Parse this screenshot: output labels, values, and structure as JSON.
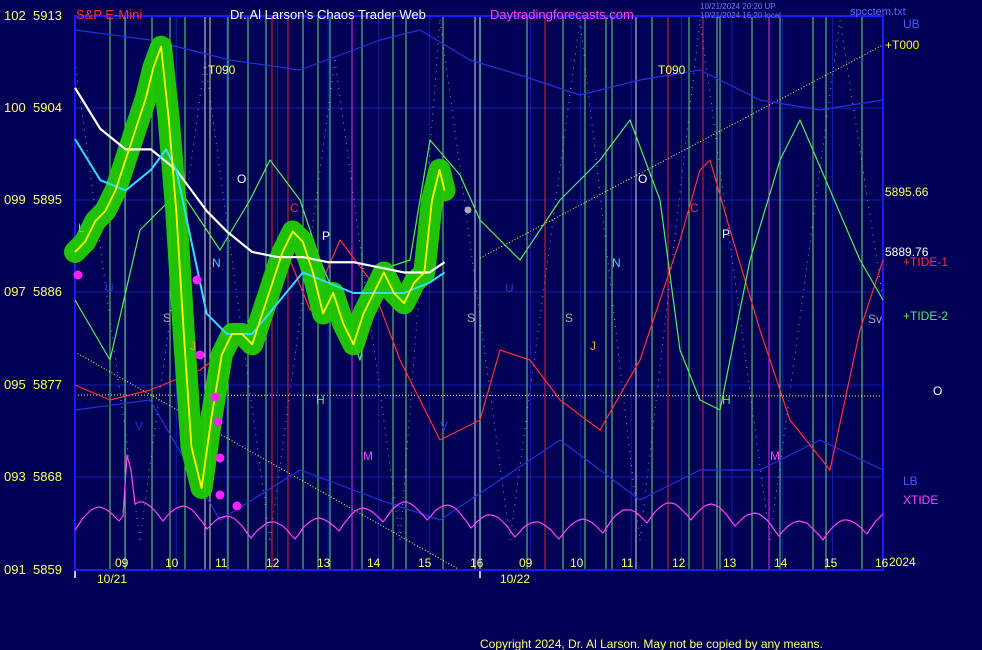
{
  "header": {
    "instrument": "S&P E-Mini",
    "title": "Dr. Al Larson's Chaos Trader Web",
    "website": "Daytradingforecasts.com",
    "stamp_line1": "10/21/2024 20:20 UP",
    "stamp_line2": "10/21/2024 16:20 local",
    "filename": "spcctem.txt"
  },
  "footer": {
    "copyright": "Copyright 2024, Dr. Al Larson. May not be copied by any means."
  },
  "colors": {
    "background": "#000055",
    "frame": "#1a1aff",
    "price_labels": "#ffff00",
    "tide1": "#ff3030",
    "tide2": "#55ee55",
    "xtide": "#ff44ff",
    "white_ma": "#ffffff",
    "cyan_ma": "#33ddff",
    "price": "#ffff00",
    "highlight": "#22cc00"
  },
  "chart_data": {
    "type": "line",
    "title": "S&P E-Mini",
    "y_axis": {
      "left_ticks": [
        "102",
        "100",
        "099",
        "097",
        "095",
        "093",
        "091"
      ],
      "right_ticks": [
        "5913",
        "5904",
        "5895",
        "5886",
        "5877",
        "5868",
        "5859"
      ],
      "ylim": [
        5859,
        5913
      ]
    },
    "x_axis": {
      "hour_labels": [
        "09",
        "10",
        "11",
        "12",
        "13",
        "14",
        "15",
        "16",
        "09",
        "10",
        "11",
        "12",
        "13",
        "14",
        "15",
        "16"
      ],
      "dates": [
        "10/21",
        "10/22"
      ],
      "year": "2024"
    },
    "right_labels": {
      "ub": "UB",
      "t000": "+T000",
      "level1": "5895.66",
      "level2": "5889.76",
      "tide1": "+TIDE-1",
      "tide2": "+TIDE-2",
      "o": "O",
      "lb": "LB",
      "xtide": "XTIDE"
    },
    "cycle_labels": {
      "t090": "T090",
      "o": "O",
      "c": "C",
      "p": "P",
      "n": "N",
      "u": "U",
      "s": "S",
      "j": "J",
      "h": "H",
      "m": "M",
      "v": "V",
      "l": "L",
      "sv": "Sv"
    },
    "series": [
      {
        "name": "S&P E-Mini",
        "x": [
          0,
          0.2,
          0.4,
          0.6,
          0.8,
          1.0,
          1.2,
          1.4,
          1.55,
          1.7,
          1.85,
          2.0,
          2.15,
          2.3,
          2.5,
          2.7,
          2.9,
          3.1,
          3.3,
          3.5,
          3.7,
          3.9,
          4.1,
          4.3,
          4.5,
          4.7,
          4.9,
          5.1,
          5.3,
          5.5,
          5.7,
          5.9,
          6.1,
          6.3,
          6.5,
          6.7,
          6.9,
          7.05,
          7.2,
          7.3
        ],
        "values": [
          5890,
          5891,
          5893,
          5894,
          5896,
          5899,
          5902,
          5905,
          5908,
          5910,
          5903,
          5894,
          5882,
          5871,
          5867,
          5874,
          5880,
          5882,
          5882,
          5881,
          5884,
          5887,
          5890,
          5892,
          5891,
          5888,
          5884,
          5886,
          5883,
          5881,
          5884,
          5886,
          5888,
          5886,
          5885,
          5887,
          5888,
          5895,
          5898,
          5896
        ]
      },
      {
        "name": "white moving average",
        "x": [
          0,
          0.5,
          1.0,
          1.5,
          2.0,
          2.3,
          2.6,
          3.0,
          3.5,
          4.0,
          4.5,
          5.0,
          5.5,
          6.0,
          6.5,
          7.0,
          7.3
        ],
        "values": [
          5906,
          5902,
          5900,
          5900,
          5898,
          5896,
          5894,
          5892,
          5890,
          5889.5,
          5889.5,
          5889,
          5889,
          5888.5,
          5888,
          5888,
          5889
        ]
      },
      {
        "name": "cyan moving average",
        "x": [
          0,
          0.5,
          1.0,
          1.5,
          1.8,
          2.0,
          2.3,
          2.6,
          3.0,
          3.5,
          4.0,
          4.5,
          5.0,
          5.5,
          6.0,
          6.5,
          7.0,
          7.3
        ],
        "values": [
          5901,
          5897,
          5896,
          5898,
          5900,
          5898,
          5891,
          5884,
          5882,
          5882,
          5885,
          5888,
          5887,
          5886,
          5886,
          5886,
          5887,
          5888
        ]
      }
    ]
  }
}
